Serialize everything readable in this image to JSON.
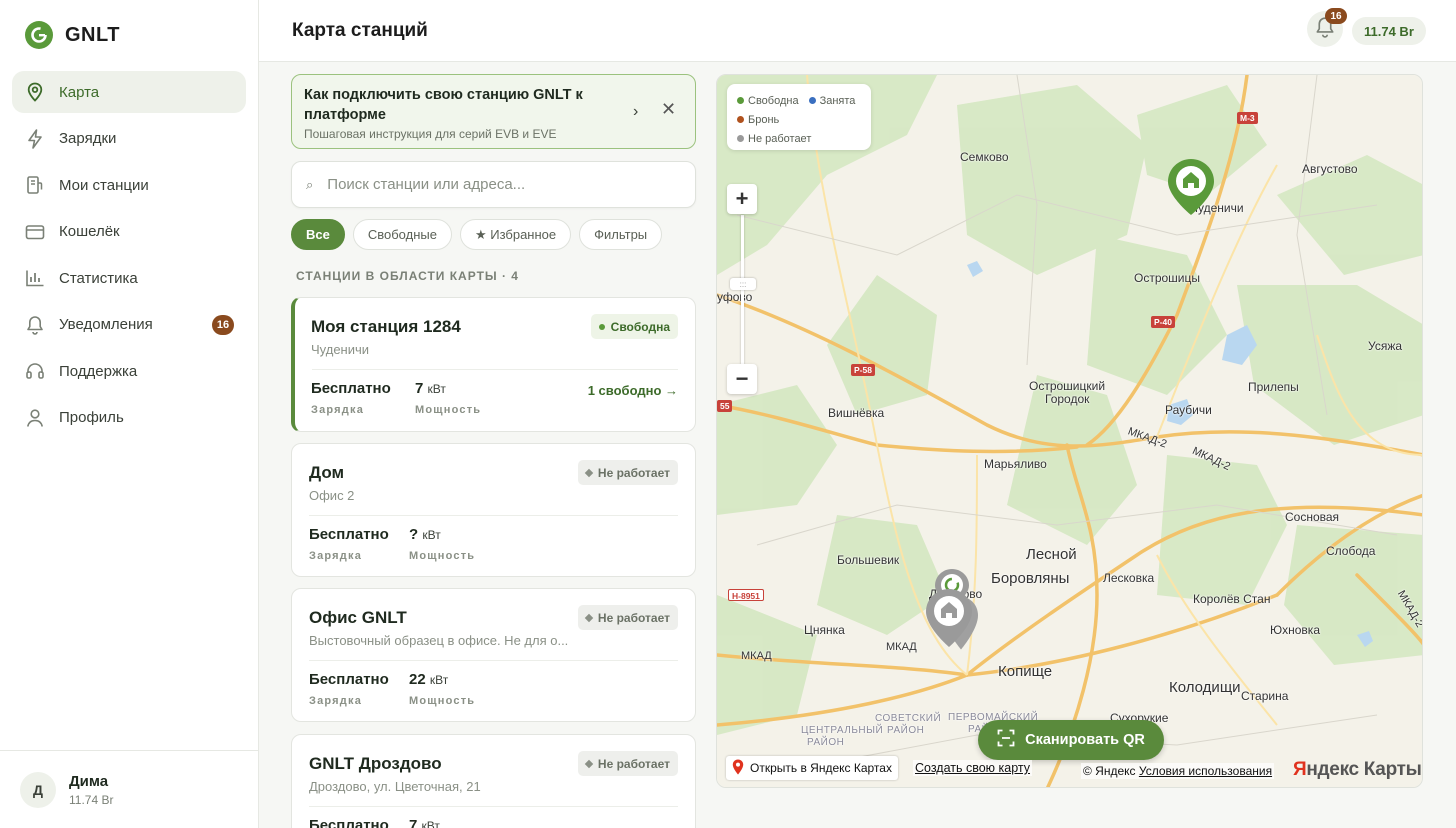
{
  "brand": {
    "name": "GNLT",
    "color": "#5a8a3c"
  },
  "nav": {
    "items": [
      {
        "label": "Карта",
        "icon": "map-pin-icon",
        "active": true
      },
      {
        "label": "Зарядки",
        "icon": "bolt-icon"
      },
      {
        "label": "Мои станции",
        "icon": "charger-icon"
      },
      {
        "label": "Кошелёк",
        "icon": "wallet-icon"
      },
      {
        "label": "Статистика",
        "icon": "chart-icon"
      },
      {
        "label": "Уведомления",
        "icon": "bell-icon",
        "badge": "16"
      },
      {
        "label": "Поддержка",
        "icon": "headset-icon"
      },
      {
        "label": "Профиль",
        "icon": "user-icon"
      }
    ]
  },
  "user": {
    "initial": "Д",
    "name": "Дима",
    "balance": "11.74 Br"
  },
  "header": {
    "title": "Карта станций",
    "notifications_count": "16",
    "balance": "11.74 Br"
  },
  "banner": {
    "title": "Как подключить свою станцию GNLT к платформе",
    "subtitle": "Пошаговая инструкция для серий EVB и EVE",
    "arrow": "›",
    "close": "✕"
  },
  "search": {
    "placeholder": "Поиск станции или адреса...",
    "value": "",
    "icon": "⌕"
  },
  "filters": {
    "all": "Все",
    "free": "Свободные",
    "favorites": "★ Избранное",
    "more": "Фильтры"
  },
  "list": {
    "header": "Станции в области карты · 4",
    "stations": [
      {
        "name": "Моя станция 1284",
        "address": "Чуденичи",
        "status": "Свободна",
        "price": "Бесплатно",
        "price_label": "Зарядка",
        "power": "7",
        "unit": "кВт",
        "power_label": "Мощность",
        "free": "1 свободно →"
      },
      {
        "name": "Дом",
        "address": "Офис 2",
        "status": "Не работает",
        "price": "Бесплатно",
        "price_label": "Зарядка",
        "power": "?",
        "unit": "кВт",
        "power_label": "Мощность"
      },
      {
        "name": "Офис GNLT",
        "address": "Выстовочный образец в офисе. Не для о...",
        "status": "Не работает",
        "price": "Бесплатно",
        "price_label": "Зарядка",
        "power": "22",
        "unit": "кВт",
        "power_label": "Мощность"
      },
      {
        "name": "GNLT Дроздово",
        "address": "Дроздово, ул. Цветочная, 21",
        "status": "Не работает",
        "price": "Бесплатно",
        "unit": "кВт",
        "power": "7"
      }
    ]
  },
  "map": {
    "legend": {
      "free": "Свободна",
      "busy": "Занята",
      "booked": "Бронь",
      "off": "Не работает"
    },
    "legend_colors": {
      "free": "#5a9a3a",
      "busy": "#3a6fc0",
      "booked": "#b0521e",
      "off": "#9a9a9a"
    },
    "zoom_in": "+",
    "zoom_out": "−",
    "zoom_handle": ":::",
    "scan_qr": "Сканировать QR",
    "open_yandex": "Открыть в Яндекс Картах",
    "create_map": "Создать свою карту",
    "copyright": "© Яндекс",
    "terms": "Условия использования",
    "logo_y": "Я",
    "logo_rest": "ндекс Карты",
    "places": {
      "semkovo": "Семково",
      "avgustovo": "Августово",
      "chudenichi": "Чуденичи",
      "ostroshitsy": "Острошицы",
      "usyazha": "Усяжа",
      "prilepy": "Прилепы",
      "ostroshitsky": "Острошицкий",
      "gorodok": "Городок",
      "raubichi": "Раубичи",
      "vishnevka": "Вишнёвка",
      "maryalivo": "Марьяливо",
      "fovo": "уфово",
      "sosnovaya": "Сосновая",
      "sloboda": "Слобода",
      "bolshevik": "Большевик",
      "lesnoy": "Лесной",
      "borovlyany": "Боровляны",
      "leskovka": "Лесковка",
      "drozdovo": "Дроздово",
      "korolev": "Королёв Стан",
      "tsnyanka": "Цнянка",
      "yuhnovka": "Юхновка",
      "kopishche": "Копище",
      "kolodishchi": "Колодищи",
      "staryna": "Старина",
      "sukharukie": "Сухорукие",
      "mkad1": "МКАД",
      "mkad2": "МКАД",
      "mkad3": "МКАД-2",
      "mkad4": "МКАД-2",
      "mkad5": "МКАД-2",
      "central": "ЦЕНТРАЛЬНЫЙ",
      "rayon1": "РАЙОН",
      "soviet": "СОВЕТСКИЙ",
      "rayon2": "РАЙОН",
      "pervomay": "ПЕРВОМАЙСКИЙ",
      "rayon3": "РАЙОН"
    },
    "roads": {
      "m3": "М-3",
      "p40": "Р-40",
      "p58": "Р-58",
      "h8951": "Н-8951",
      "r55": "55"
    }
  }
}
